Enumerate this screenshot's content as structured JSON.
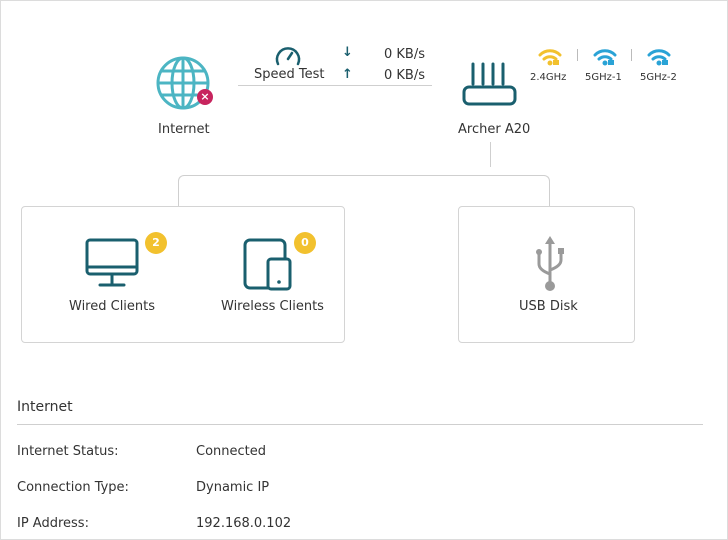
{
  "internet_node": {
    "label": "Internet",
    "status_icon": "disconnected-x-icon",
    "icon": "globe-icon"
  },
  "speed_test": {
    "label": "Speed Test",
    "download": "0 KB/s",
    "upload": "0 KB/s",
    "icon": "speedometer-icon"
  },
  "router": {
    "label": "Archer A20",
    "icon": "router-icon"
  },
  "wifi_bands": [
    {
      "label": "2.4GHz",
      "color": "#f2c12e",
      "icon": "wifi-icon"
    },
    {
      "label": "5GHz-1",
      "color": "#2aa3d6",
      "icon": "wifi-icon"
    },
    {
      "label": "5GHz-2",
      "color": "#2aa3d6",
      "icon": "wifi-icon"
    }
  ],
  "clients": {
    "wired": {
      "label": "Wired Clients",
      "count": "2",
      "icon": "monitor-icon"
    },
    "wireless": {
      "label": "Wireless Clients",
      "count": "0",
      "icon": "tablet-phone-icon"
    }
  },
  "usb": {
    "label": "USB Disk",
    "icon": "usb-icon"
  },
  "internet_section": {
    "title": "Internet",
    "rows": [
      {
        "label": "Internet Status:",
        "value": "Connected"
      },
      {
        "label": "Connection Type:",
        "value": "Dynamic IP"
      },
      {
        "label": "IP Address:",
        "value": "192.168.0.102"
      }
    ]
  },
  "colors": {
    "accent": "#1a5f6e",
    "teal_icon": "#4cb5c3",
    "badge": "#f2c12e",
    "error": "#c7245e"
  }
}
